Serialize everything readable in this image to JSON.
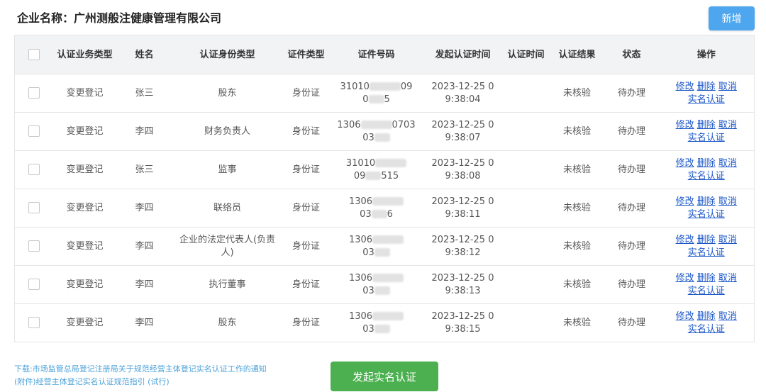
{
  "header": {
    "company_label": "企业名称：广州测般注健康管理有限公司",
    "add_button": "新增"
  },
  "table": {
    "columns": {
      "business_type": "认证业务类型",
      "name": "姓名",
      "identity_type": "认证身份类型",
      "id_type": "证件类型",
      "id_number": "证件号码",
      "start_time": "发起认证时间",
      "auth_time": "认证时间",
      "auth_result": "认证结果",
      "status": "状态",
      "actions": "操作"
    },
    "rows": [
      {
        "business_type": "变更登记",
        "name": "张三",
        "identity_type": "股东",
        "id_type": "身份证",
        "id_line1": "31010",
        "id_line2": "0",
        "id_tail1": "09",
        "id_tail2": "5",
        "start_line1": "2023-12-25 0",
        "start_line2": "9:38:04",
        "auth_time": "",
        "auth_result": "未核验",
        "status": "待办理"
      },
      {
        "business_type": "变更登记",
        "name": "李四",
        "identity_type": "财务负责人",
        "id_type": "身份证",
        "id_line1": "1306",
        "id_line2": "03",
        "id_tail1": "0703",
        "id_tail2": "",
        "start_line1": "2023-12-25 0",
        "start_line2": "9:38:07",
        "auth_time": "",
        "auth_result": "未核验",
        "status": "待办理"
      },
      {
        "business_type": "变更登记",
        "name": "张三",
        "identity_type": "监事",
        "id_type": "身份证",
        "id_line1": "31010",
        "id_line2": "09",
        "id_tail1": "",
        "id_tail2": "515",
        "start_line1": "2023-12-25 0",
        "start_line2": "9:38:08",
        "auth_time": "",
        "auth_result": "未核验",
        "status": "待办理"
      },
      {
        "business_type": "变更登记",
        "name": "李四",
        "identity_type": "联络员",
        "id_type": "身份证",
        "id_line1": "1306",
        "id_line2": "03",
        "id_tail1": "",
        "id_tail2": "6",
        "start_line1": "2023-12-25 0",
        "start_line2": "9:38:11",
        "auth_time": "",
        "auth_result": "未核验",
        "status": "待办理"
      },
      {
        "business_type": "变更登记",
        "name": "李四",
        "identity_type": "企业的法定代表人(负责人)",
        "id_type": "身份证",
        "id_line1": "1306",
        "id_line2": "03",
        "id_tail1": "",
        "id_tail2": "",
        "start_line1": "2023-12-25 0",
        "start_line2": "9:38:12",
        "auth_time": "",
        "auth_result": "未核验",
        "status": "待办理"
      },
      {
        "business_type": "变更登记",
        "name": "李四",
        "identity_type": "执行董事",
        "id_type": "身份证",
        "id_line1": "1306",
        "id_line2": "03",
        "id_tail1": "",
        "id_tail2": "",
        "start_line1": "2023-12-25 0",
        "start_line2": "9:38:13",
        "auth_time": "",
        "auth_result": "未核验",
        "status": "待办理"
      },
      {
        "business_type": "变更登记",
        "name": "李四",
        "identity_type": "股东",
        "id_type": "身份证",
        "id_line1": "1306",
        "id_line2": "03",
        "id_tail1": "",
        "id_tail2": "",
        "start_line1": "2023-12-25 0",
        "start_line2": "9:38:15",
        "auth_time": "",
        "auth_result": "未核验",
        "status": "待办理"
      }
    ],
    "action_edit": "修改",
    "action_delete": "删除",
    "action_cancel": "取消",
    "action_verify": "实名认证"
  },
  "footer": {
    "notice_line1": "下载:市场监管总局登记注册局关于规范经营主体登记实名认证工作的通知",
    "notice_line2": "(附件)经营主体登记实名认证规范指引 (试行)",
    "start_button": "发起实名认证"
  }
}
